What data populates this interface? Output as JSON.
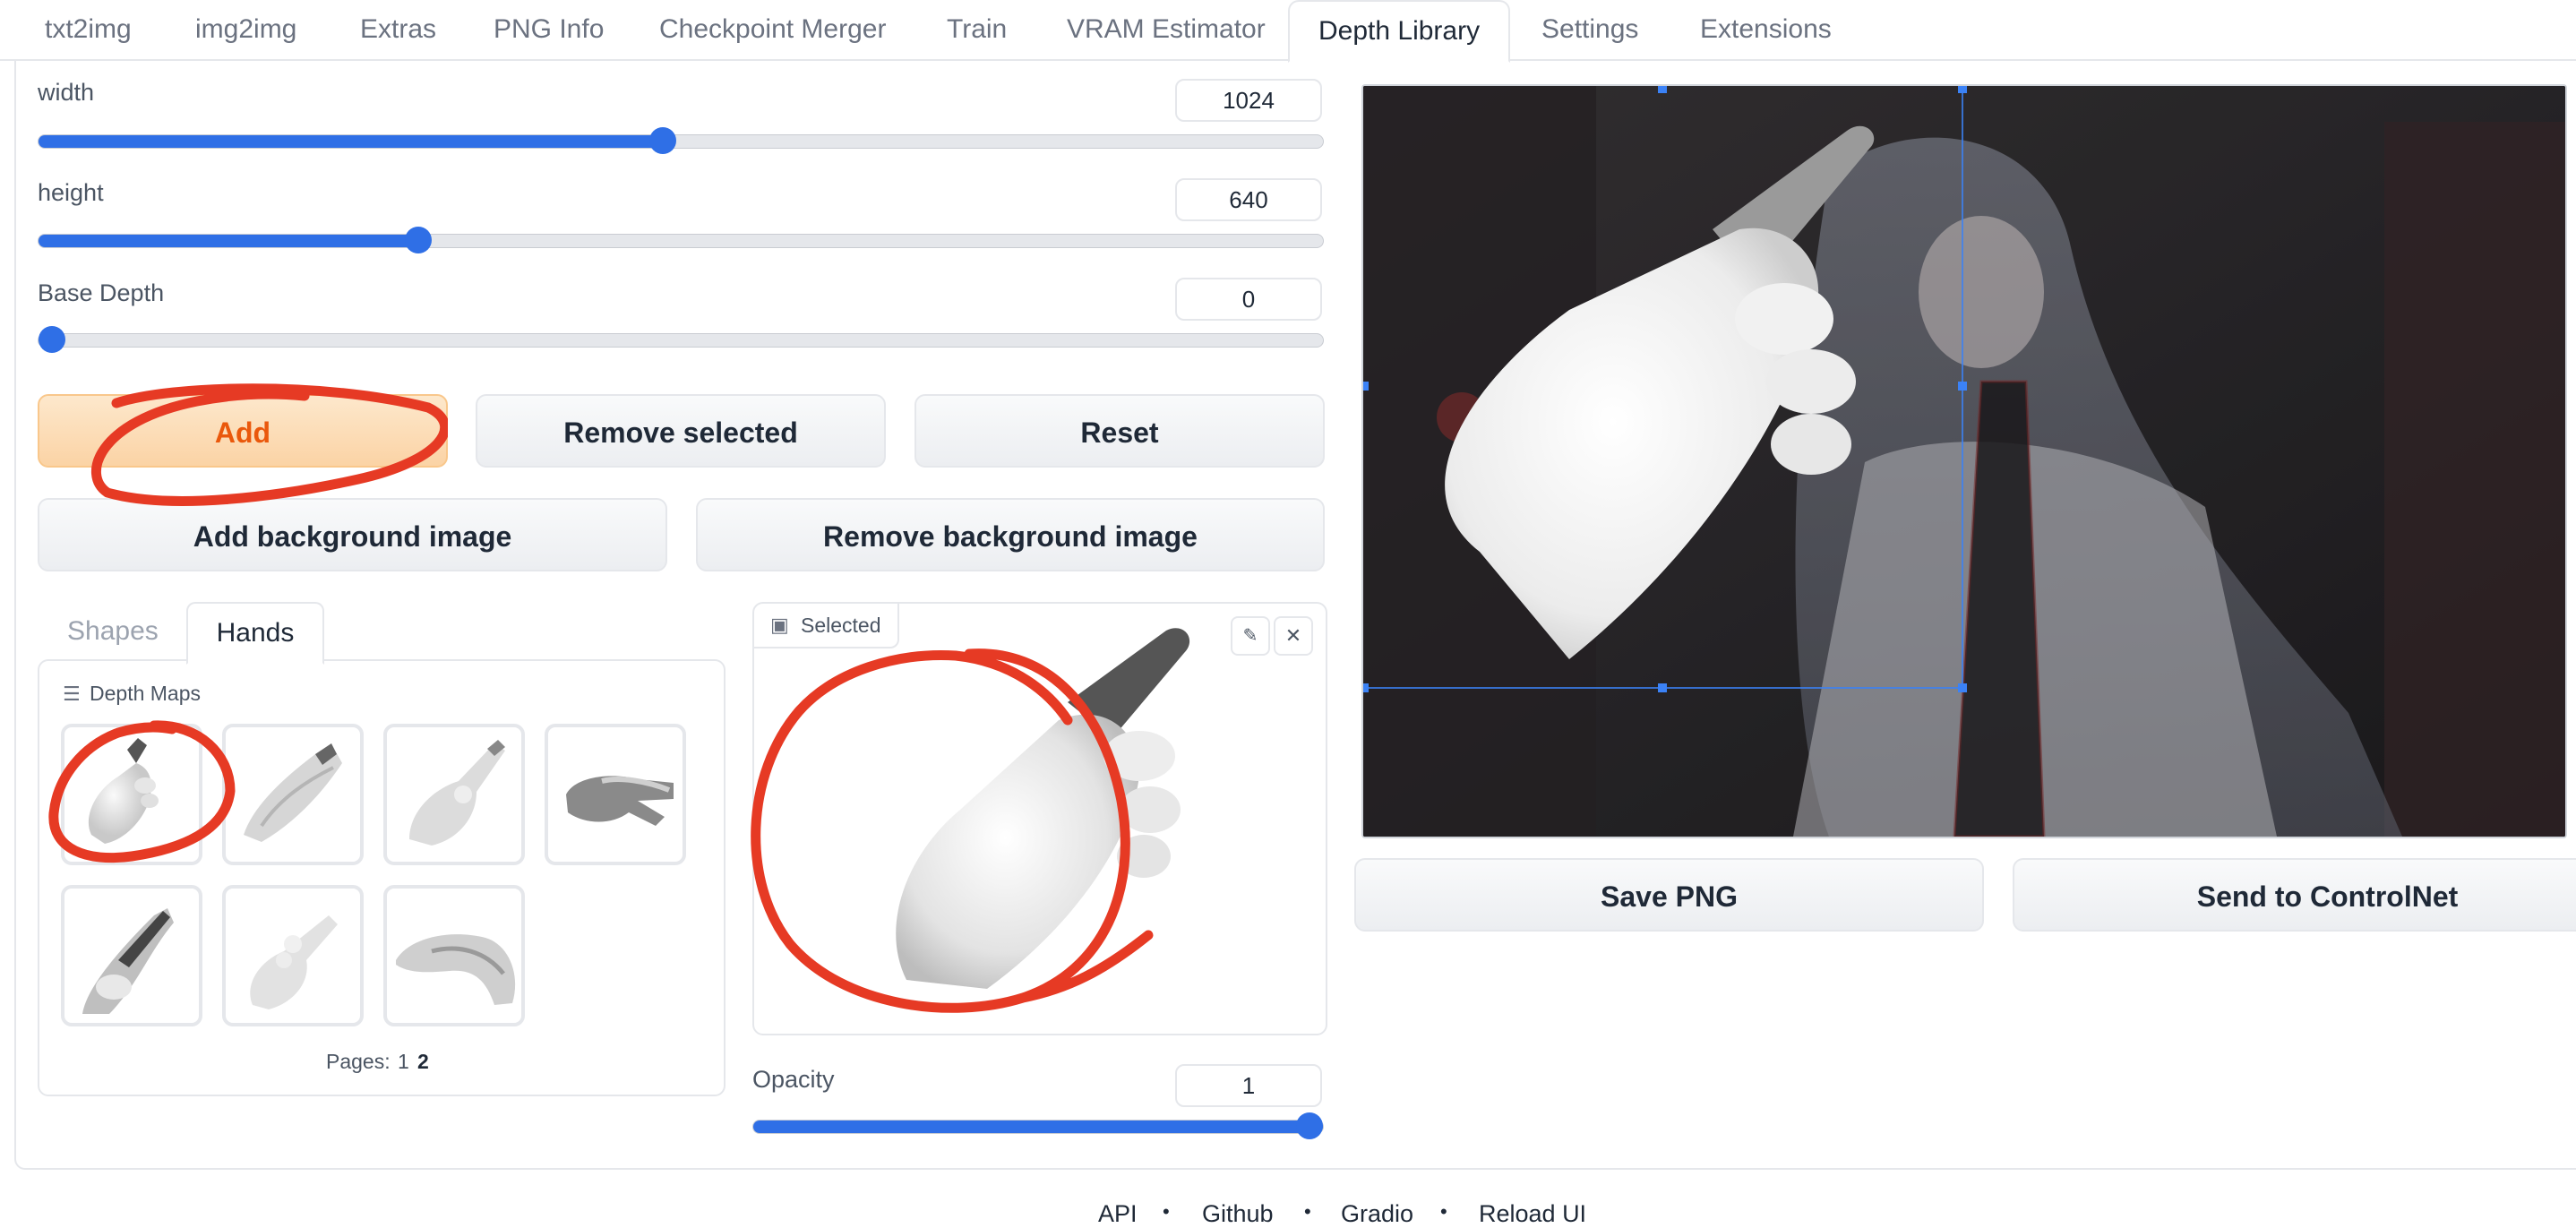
{
  "tabs": [
    "txt2img",
    "img2img",
    "Extras",
    "PNG Info",
    "Checkpoint Merger",
    "Train",
    "VRAM Estimator",
    "Depth Library",
    "Settings",
    "Extensions"
  ],
  "active_tab": "Depth Library",
  "sliders": {
    "width": {
      "label": "width",
      "value": "1024",
      "fraction": 0.486
    },
    "height": {
      "label": "height",
      "value": "640",
      "fraction": 0.296
    },
    "base_depth": {
      "label": "Base Depth",
      "value": "0",
      "fraction": 0.0
    },
    "opacity": {
      "label": "Opacity",
      "value": "1",
      "fraction": 1.0
    }
  },
  "buttons": {
    "add": "Add",
    "remove_selected": "Remove selected",
    "reset": "Reset",
    "add_bg": "Add background image",
    "remove_bg": "Remove background image",
    "save_png": "Save PNG",
    "send_controlnet": "Send to ControlNet"
  },
  "library": {
    "tabs": [
      "Shapes",
      "Hands"
    ],
    "active": "Hands",
    "header": "Depth Maps",
    "pages_label": "Pages:",
    "pages": [
      "1",
      "2"
    ]
  },
  "selected": {
    "label": "Selected"
  },
  "footer": [
    "API",
    "Github",
    "Gradio",
    "Reload UI"
  ],
  "colors": {
    "accent": "#2f6fe6",
    "primary_bg": "#fbd3a5",
    "primary_text": "#ea580c",
    "annotation": "#e63a24"
  }
}
